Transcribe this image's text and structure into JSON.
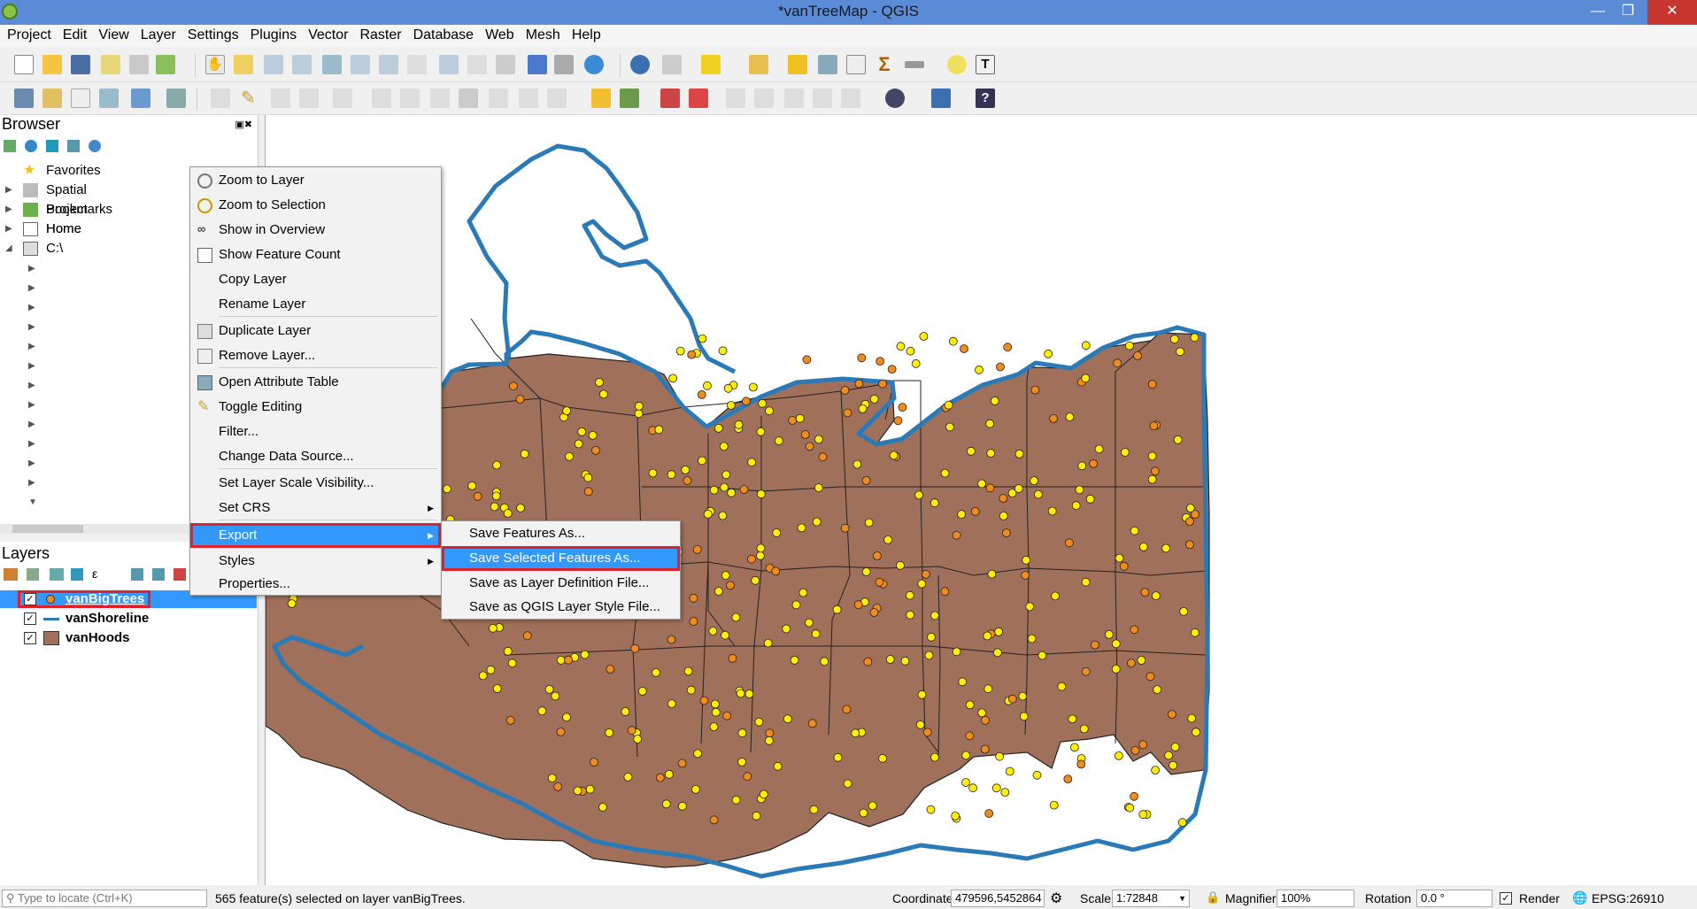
{
  "window": {
    "title": "*vanTreeMap - QGIS"
  },
  "menubar": [
    "Project",
    "Edit",
    "View",
    "Layer",
    "Settings",
    "Plugins",
    "Vector",
    "Raster",
    "Database",
    "Web",
    "Mesh",
    "Help"
  ],
  "browser": {
    "title": "Browser",
    "items": [
      {
        "label": "Favorites",
        "icon": "star-icon"
      },
      {
        "label": "Spatial Bookmarks",
        "icon": "bookmark-icon"
      },
      {
        "label": "Project Home",
        "icon": "project-home-icon"
      },
      {
        "label": "Home",
        "icon": "home-icon"
      },
      {
        "label": "C:\\",
        "icon": "drive-icon"
      }
    ]
  },
  "layers": {
    "title": "Layers",
    "items": [
      {
        "label": "vanBigTrees",
        "checked": true,
        "selected": true
      },
      {
        "label": "vanShoreline",
        "checked": true
      },
      {
        "label": "vanHoods",
        "checked": true
      }
    ]
  },
  "context_menu": {
    "items": [
      "Zoom to Layer",
      "Zoom to Selection",
      "Show in Overview",
      "Show Feature Count",
      "Copy Layer",
      "Rename Layer",
      "Duplicate Layer",
      "Remove Layer...",
      "Open Attribute Table",
      "Toggle Editing",
      "Filter...",
      "Change Data Source...",
      "Set Layer Scale Visibility...",
      "Set CRS",
      "Export",
      "Styles",
      "Properties..."
    ],
    "highlighted": "Export"
  },
  "export_submenu": {
    "items": [
      "Save Features As...",
      "Save Selected Features As...",
      "Save as Layer Definition File...",
      "Save as QGIS Layer Style File..."
    ],
    "highlighted": "Save Selected Features As..."
  },
  "statusbar": {
    "locate_placeholder": "Type to locate (Ctrl+K)",
    "message": "565 feature(s) selected on layer vanBigTrees.",
    "coordinate_label": "Coordinate",
    "coordinate": "479596,5452864",
    "scale_label": "Scale",
    "scale": "1:72848",
    "magnifier_label": "Magnifier",
    "magnifier": "100%",
    "rotation_label": "Rotation",
    "rotation": "0.0 °",
    "render_label": "Render",
    "crs": "EPSG:26910"
  },
  "colors": {
    "hood_fill": "#a0705a",
    "shoreline": "#2a7ab8",
    "tree_yellow": "#ffee00",
    "tree_orange": "#f08c1e",
    "highlight": "#3399ff",
    "callout": "#e0202b"
  }
}
